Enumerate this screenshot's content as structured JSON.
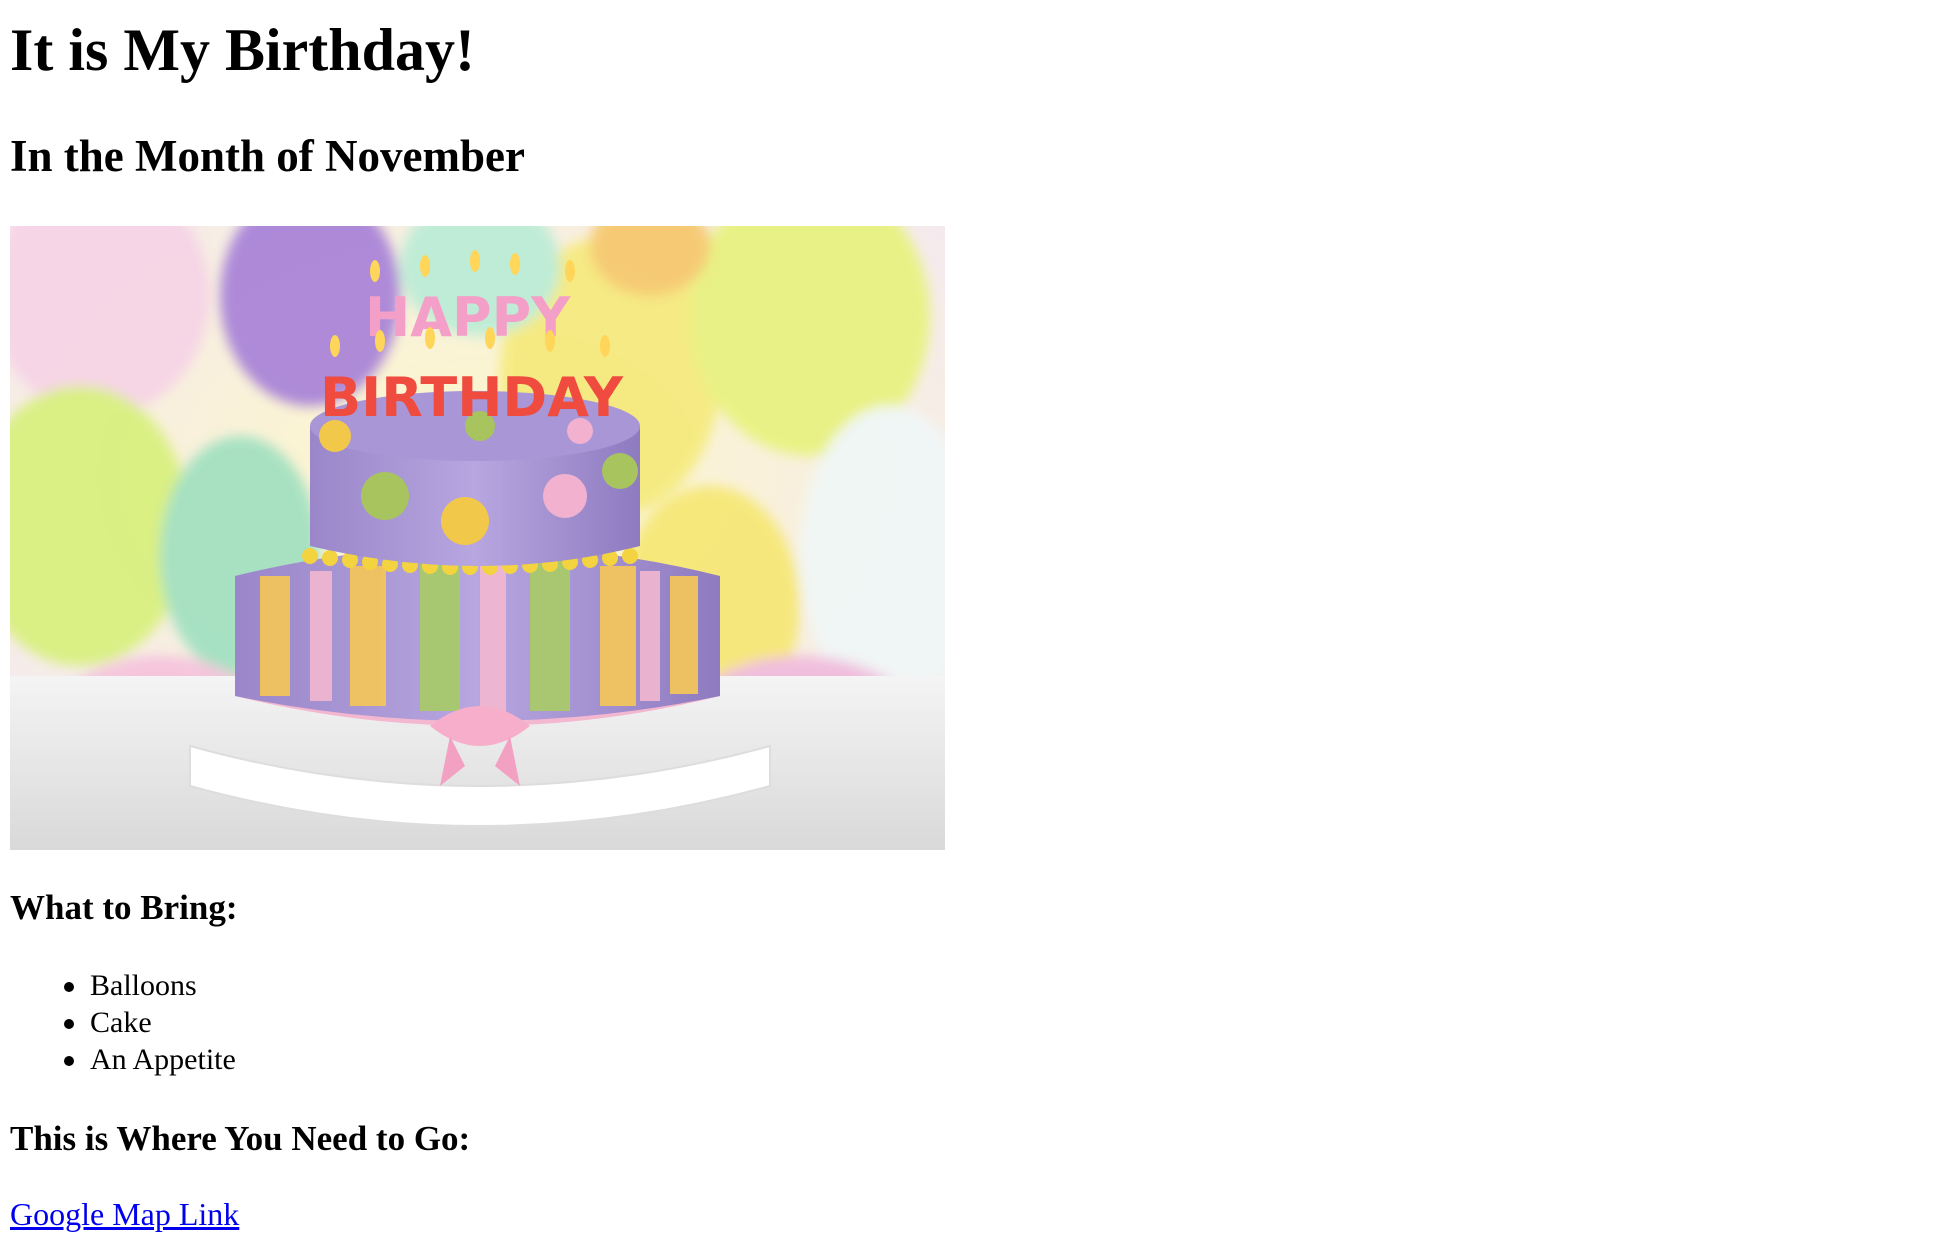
{
  "page": {
    "title": "It is My Birthday!",
    "subtitle": "In the Month of November"
  },
  "hero_image": {
    "description_icon": "birthday-cake-photo",
    "candle_text_top": "HAPPY",
    "candle_text_bottom": "BIRTHDAY"
  },
  "bring": {
    "heading": "What to Bring:",
    "items": [
      "Balloons",
      "Cake",
      "An Appetite"
    ]
  },
  "directions": {
    "heading": "This is Where You Need to Go:",
    "link_text": "Google Map Link"
  },
  "colors": {
    "link": "#0000ee",
    "text": "#000000",
    "background": "#ffffff"
  }
}
